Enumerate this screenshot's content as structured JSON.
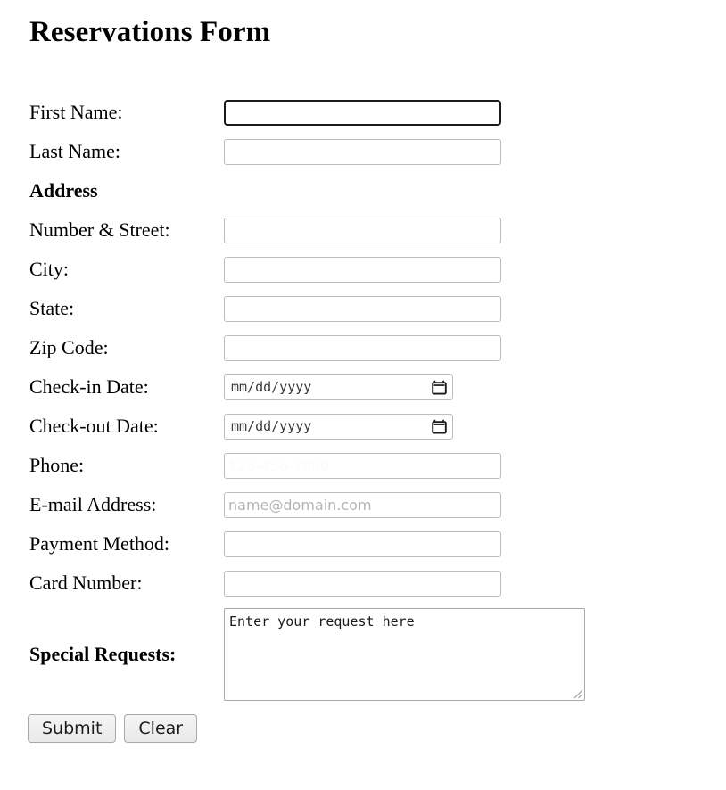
{
  "page": {
    "title": "Reservations Form",
    "background_color": "#ffffff",
    "text_color": "#000000"
  },
  "form": {
    "rows": [
      {
        "label": "First Name:",
        "label_bold": false,
        "control": "text",
        "value": "",
        "placeholder": "",
        "focused": true
      },
      {
        "label": "Last Name:",
        "label_bold": false,
        "control": "text",
        "value": "",
        "placeholder": "",
        "focused": false
      },
      {
        "label": "Address",
        "label_bold": true,
        "control": "none",
        "value": "",
        "placeholder": "",
        "focused": false
      },
      {
        "label": "Number & Street:",
        "label_bold": false,
        "control": "text",
        "value": "",
        "placeholder": "",
        "focused": false
      },
      {
        "label": "City:",
        "label_bold": false,
        "control": "text",
        "value": "",
        "placeholder": "",
        "focused": false
      },
      {
        "label": "State:",
        "label_bold": false,
        "control": "text",
        "value": "",
        "placeholder": "",
        "focused": false
      },
      {
        "label": "Zip Code:",
        "label_bold": false,
        "control": "text",
        "value": "",
        "placeholder": "",
        "focused": false
      },
      {
        "label": "Check-in Date:",
        "label_bold": false,
        "control": "date",
        "value": "",
        "placeholder": "mm/dd/yyyy",
        "icon": "calendar-icon",
        "focused": false
      },
      {
        "label": "Check-out Date:",
        "label_bold": false,
        "control": "date",
        "value": "",
        "placeholder": "mm/dd/yyyy",
        "icon": "calendar-icon",
        "focused": false
      },
      {
        "label": "Phone:",
        "label_bold": false,
        "control": "tel",
        "value": "",
        "placeholder": "123-456-7890",
        "placeholder_faint": true,
        "focused": false
      },
      {
        "label": "E-mail Address:",
        "label_bold": false,
        "control": "email",
        "value": "",
        "placeholder": "name@domain.com",
        "focused": false
      },
      {
        "label": "Payment Method:",
        "label_bold": false,
        "control": "text",
        "value": "",
        "placeholder": "",
        "focused": false
      },
      {
        "label": "Card Number:",
        "label_bold": false,
        "control": "text",
        "value": "",
        "placeholder": "",
        "focused": false
      }
    ],
    "special_requests": {
      "label": "Special Requests:",
      "label_bold": true,
      "value": "Enter your request here"
    }
  },
  "actions": {
    "submit_label": "Submit",
    "clear_label": "Clear"
  }
}
